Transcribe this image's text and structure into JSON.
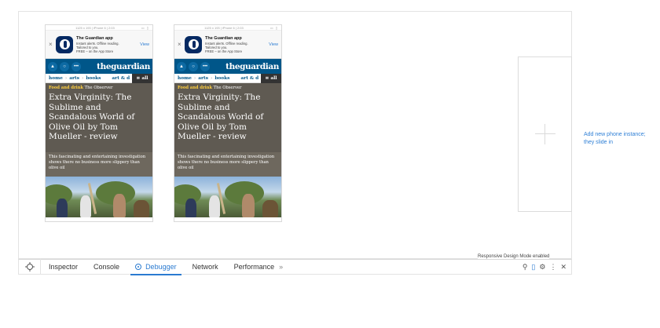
{
  "phone": {
    "status_dims": "1125 x 193",
    "status_device": "iPhone 6",
    "status_time": "2:03",
    "banner": {
      "close": "×",
      "title": "The Guardian app",
      "line1": "Instant alerts. Offline reading.",
      "line2": "Tailored to you.",
      "line3": "FREE – on the App Store",
      "view": "View"
    },
    "logo": "theguardian",
    "nav": {
      "home": "home",
      "arts": "arts",
      "books": "books",
      "artcut": "art & d",
      "all": "≡ all"
    },
    "kicker_section": "Food and drink",
    "kicker_source": "The Observer",
    "headline": "Extra Virginity: The Sublime and Scandalous World of Olive Oil by Tom Mueller - review",
    "standfirst": "This fascinating and entertaining investigation shows there no business more slippery than olive oil"
  },
  "side_note": "Add new phone instance; they slide in",
  "toolbar": {
    "tabs": {
      "inspector": "Inspector",
      "console": "Console",
      "debugger": "Debugger",
      "network": "Network",
      "performance": "Performance"
    },
    "more": "»",
    "rdm_label": "Responsive Design Mode enabled"
  },
  "icons": [
    "picker-icon",
    "debugger-icon",
    "search-icon",
    "phone-icon",
    "gear-icon",
    "more-vertical-icon",
    "close-icon",
    "plus-icon",
    "account-icon",
    "menu-icon"
  ],
  "colors": {
    "guardian_blue": "#005689",
    "accent": "#2b7bd1",
    "kicker": "#ffcf3f",
    "hero_bg": "#5f5a52"
  }
}
